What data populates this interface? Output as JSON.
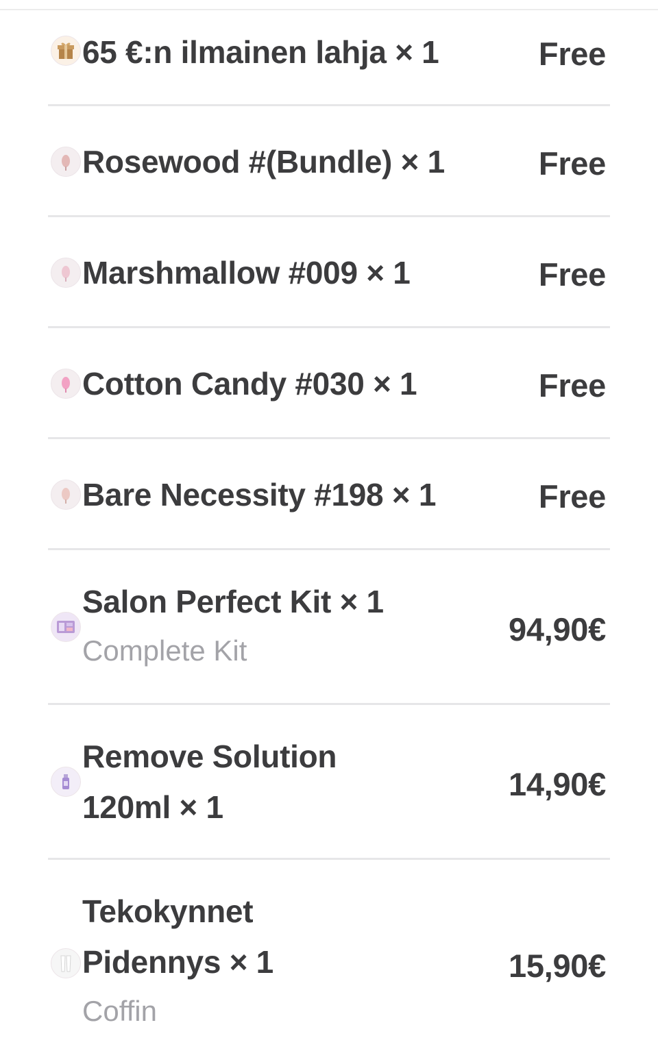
{
  "items": [
    {
      "name": "65 €:n ilmainen lahja × 1",
      "price": "Free",
      "icon": "gift-box-icon"
    },
    {
      "name": "Rosewood #(Bundle) × 1",
      "price": "Free",
      "icon": "nail-polish-icon"
    },
    {
      "name": "Marshmallow #009 × 1",
      "price": "Free",
      "icon": "nail-polish-icon"
    },
    {
      "name": "Cotton Candy #030 × 1",
      "price": "Free",
      "icon": "nail-polish-icon"
    },
    {
      "name": "Bare Necessity #198 × 1",
      "price": "Free",
      "icon": "nail-polish-icon"
    },
    {
      "name": "Salon Perfect Kit × 1",
      "variant": "Complete Kit",
      "price": "94,90€",
      "icon": "kit-box-icon"
    },
    {
      "name_line1": "Remove Solution",
      "name_line2": "120ml × 1",
      "price": "14,90€",
      "icon": "bottle-icon"
    },
    {
      "name_line1": "Tekokynnet",
      "name_line2": "Pidennys × 1",
      "variant": "Coffin",
      "price": "15,90€",
      "icon": "nail-tips-icon"
    }
  ],
  "colors": {
    "text": "#3c3c3e",
    "muted": "#a3a3a8",
    "divider": "#e6e6e8"
  }
}
